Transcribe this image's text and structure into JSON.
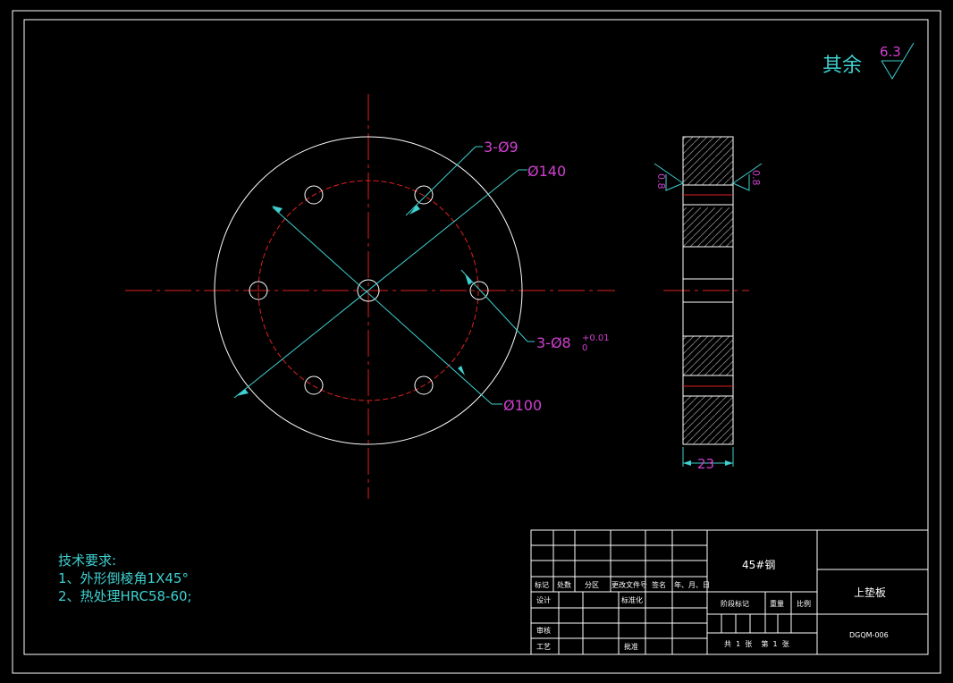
{
  "roughness": {
    "label": "其余",
    "value": "6.3"
  },
  "dimensions": {
    "holes_small": "3-Ø9",
    "bolt_circle": "Ø140",
    "holes_pin": "3-Ø8",
    "tol_upper": "+0.01",
    "tol_lower": "0",
    "inner_circle": "Ø100",
    "thickness": "23",
    "surface_left": "0.8",
    "surface_right": "0.8"
  },
  "notes": {
    "title": "技术要求:",
    "items": [
      "1、外形倒棱角1X45°",
      "2、热处理HRC58-60;"
    ]
  },
  "title_block": {
    "material": "45#钢",
    "part_name": "上垫板",
    "drawing_no": "DGQM-006",
    "rev_headers": [
      "标记",
      "处数",
      "分区",
      "更改文件号",
      "签名",
      "年、月、日"
    ],
    "design": "设计",
    "standard": "标准化",
    "stage": "阶段标记",
    "weight": "重量",
    "scale": "比例",
    "review": "审核",
    "process": "工艺",
    "approve": "批准",
    "sheets": "共  1  张    第  1  张"
  },
  "colors": {
    "cyan": "#3fd0d0",
    "magenta": "#d040d0",
    "red": "#e02020",
    "line": "#ffffff"
  }
}
